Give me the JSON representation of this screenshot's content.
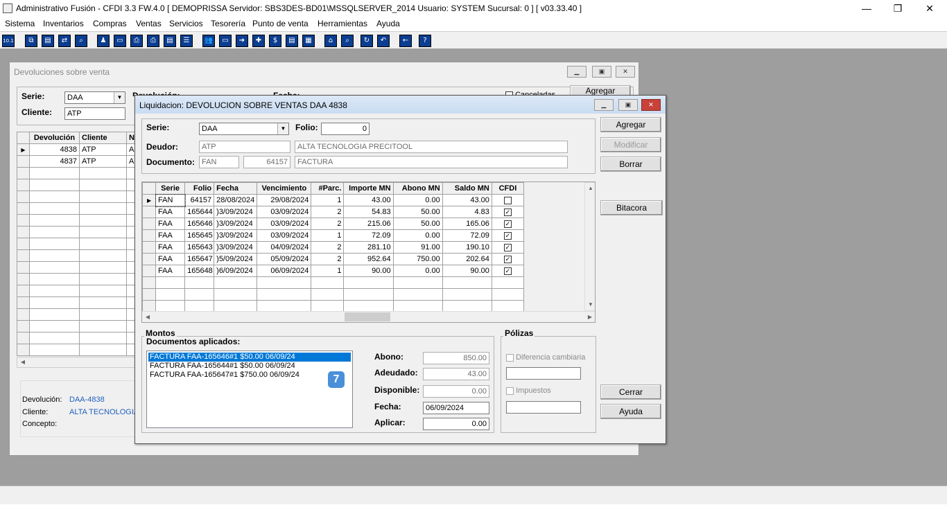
{
  "app": {
    "title": "Administrativo Fusión - CFDI 3.3 FW.4.0 [ DEMOPRISSA   Servidor: SBS3DES-BD01\\MSSQLSERVER_2014   Usuario: SYSTEM    Sucursal: 0 ] [ v03.33.40 ]",
    "minimize": "—",
    "restore": "❐",
    "close": "✕"
  },
  "menu": [
    "Sistema",
    "Inventarios",
    "Compras",
    "Ventas",
    "Servicios",
    "Tesorería",
    "Punto de venta",
    "Herramientas",
    "Ayuda"
  ],
  "toolbar": {
    "first": "10.1",
    "icons": [
      "copy-icon",
      "clipboard-icon",
      "transfer-icon",
      "search-doc-icon",
      "user-icon",
      "folder-icon",
      "print-icon",
      "printer-icon",
      "document-icon",
      "list-icon",
      "people-icon",
      "box-icon",
      "export-icon",
      "add-icon",
      "dollar-icon",
      "report-icon",
      "table-icon",
      "home-icon",
      "zoom-icon",
      "refresh-icon",
      "undo-icon",
      "back-arrow-icon",
      "help-icon"
    ],
    "glyphs": [
      "⧉",
      "▤",
      "⇄",
      "⌕",
      "♟",
      "▭",
      "⎙",
      "⎙",
      "▤",
      "☰",
      "👥",
      "▭",
      "➔",
      "✚",
      "$",
      "▤",
      "▦",
      "⌂",
      "⌕",
      "↻",
      "↶",
      "←",
      "?"
    ]
  },
  "bgwin": {
    "title": "Devoluciones sobre venta",
    "serie_label": "Serie:",
    "serie_value": "DAA",
    "cliente_label": "Cliente:",
    "cliente_value": "ATP",
    "devolucion_label": "Devolución:",
    "fecha_label": "Fecha:",
    "canceladas_label": "Canceladas",
    "agregar_label": "Agregar",
    "columns": [
      "Devolución",
      "Cliente",
      "N"
    ],
    "rows": [
      {
        "devolucion": "4838",
        "cliente": "ATP",
        "n": "A"
      },
      {
        "devolucion": "4837",
        "cliente": "ATP",
        "n": "A"
      }
    ],
    "footer": {
      "devolucion_label": "Devolución:",
      "devolucion_value": "DAA-4838",
      "cliente_label": "Cliente:",
      "cliente_value": "ALTA TECNOLOGIA",
      "concepto_label": "Concepto:"
    }
  },
  "dialog": {
    "title": "Liquidacion: DEVOLUCION SOBRE VENTAS DAA 4838",
    "serie_label": "Serie:",
    "serie_value": "DAA",
    "folio_label": "Folio:",
    "folio_value": "0",
    "deudor_label": "Deudor:",
    "deudor_code": "ATP",
    "deudor_name": "ALTA TECNOLOGIA PRECITOOL",
    "documento_label": "Documento:",
    "documento_serie": "FAN",
    "documento_folio": "64157",
    "documento_tipo": "FACTURA",
    "buttons": {
      "agregar": "Agregar",
      "modificar": "Modificar",
      "borrar": "Borrar",
      "bitacora": "Bitacora",
      "cerrar": "Cerrar",
      "ayuda": "Ayuda"
    },
    "grid": {
      "columns": [
        "Serie",
        "Folio",
        "Fecha",
        "Vencimiento",
        "#Parc.",
        "Importe MN",
        "Abono MN",
        "Saldo MN",
        "CFDI"
      ],
      "rows": [
        {
          "serie": "FAN",
          "folio": "64157",
          "fecha": "28/08/2024",
          "venc": "29/08/2024",
          "parc": "1",
          "importe": "43.00",
          "abono": "0.00",
          "saldo": "43.00",
          "cfdi": false
        },
        {
          "serie": "FAA",
          "folio": "165644",
          "fecha": ")3/09/2024",
          "venc": "03/09/2024",
          "parc": "2",
          "importe": "54.83",
          "abono": "50.00",
          "saldo": "4.83",
          "cfdi": true
        },
        {
          "serie": "FAA",
          "folio": "165646",
          "fecha": ")3/09/2024",
          "venc": "03/09/2024",
          "parc": "2",
          "importe": "215.06",
          "abono": "50.00",
          "saldo": "165.06",
          "cfdi": true
        },
        {
          "serie": "FAA",
          "folio": "165645",
          "fecha": ")3/09/2024",
          "venc": "03/09/2024",
          "parc": "1",
          "importe": "72.09",
          "abono": "0.00",
          "saldo": "72.09",
          "cfdi": true
        },
        {
          "serie": "FAA",
          "folio": "165643",
          "fecha": ")3/09/2024",
          "venc": "04/09/2024",
          "parc": "2",
          "importe": "281.10",
          "abono": "91.00",
          "saldo": "190.10",
          "cfdi": true
        },
        {
          "serie": "FAA",
          "folio": "165647",
          "fecha": ")5/09/2024",
          "venc": "05/09/2024",
          "parc": "2",
          "importe": "952.64",
          "abono": "750.00",
          "saldo": "202.64",
          "cfdi": true
        },
        {
          "serie": "FAA",
          "folio": "165648",
          "fecha": ")6/09/2024",
          "venc": "06/09/2024",
          "parc": "1",
          "importe": "90.00",
          "abono": "0.00",
          "saldo": "90.00",
          "cfdi": true
        }
      ]
    },
    "montos": {
      "title": "Montos",
      "docs_label": "Documentos aplicados:",
      "docs": [
        "FACTURA FAA-165646#1 $50.00 06/09/24",
        "FACTURA FAA-165644#1 $50.00 06/09/24",
        "FACTURA FAA-165647#1 $750.00 06/09/24"
      ],
      "badge": "7",
      "abono_label": "Abono:",
      "abono_value": "850.00",
      "adeudado_label": "Adeudado:",
      "adeudado_value": "43.00",
      "disponible_label": "Disponible:",
      "disponible_value": "0.00",
      "fecha_label": "Fecha:",
      "fecha_value": "06/09/2024",
      "aplicar_label": "Aplicar:",
      "aplicar_value": "0.00"
    },
    "polizas": {
      "title": "Pólizas",
      "diferencia_label": "Diferencia cambiaria",
      "impuestos_label": "Impuestos"
    }
  }
}
